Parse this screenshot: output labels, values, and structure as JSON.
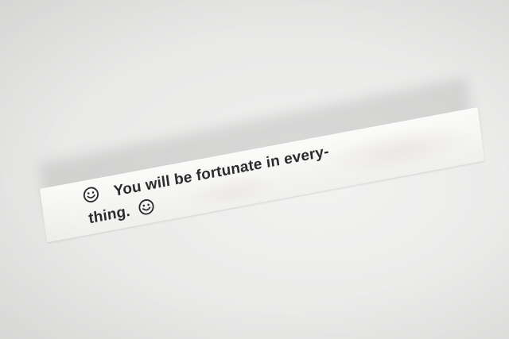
{
  "fortune": {
    "line1_text": "You will be fortunate in every-",
    "line2_text": "thing.",
    "icons": {
      "leading": "smiley-face-icon",
      "trailing": "smiley-face-icon"
    }
  },
  "colors": {
    "background": "#ebebea",
    "paper": "#f7f7f5",
    "ink": "#2b2b2b"
  }
}
